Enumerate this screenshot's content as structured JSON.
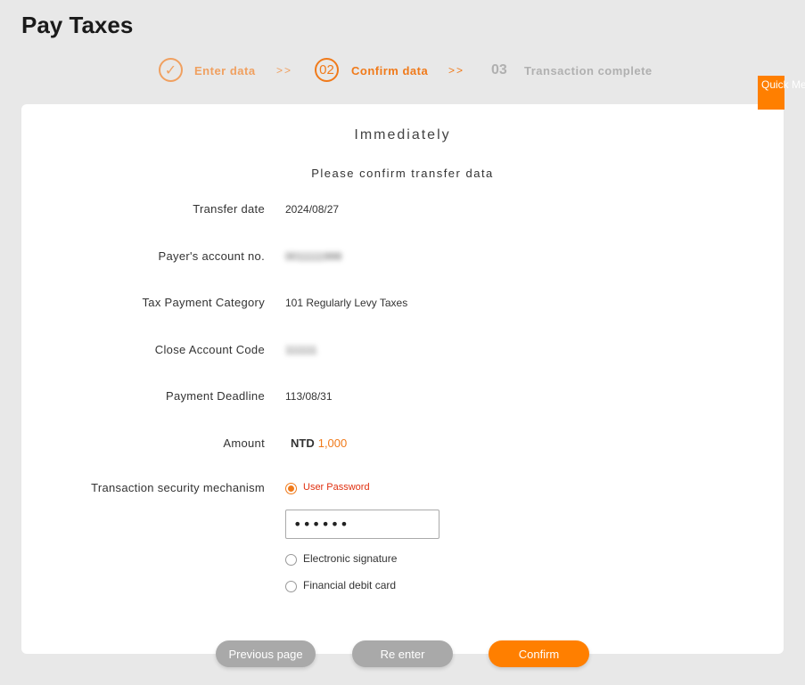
{
  "page": {
    "title": "Pay Taxes"
  },
  "stepper": {
    "step1": {
      "icon": "check-icon",
      "symbol": "✓",
      "label": "Enter data",
      "status": "done"
    },
    "separator1": ">>",
    "step2": {
      "number": "02",
      "label": "Confirm data",
      "status": "active"
    },
    "separator2": ">>",
    "step3": {
      "number": "03",
      "label": "Transaction complete",
      "status": "pending"
    }
  },
  "quick_menu": {
    "label": "Quick Menu"
  },
  "card": {
    "title": "Immediately",
    "subtitle": "Please confirm transfer data",
    "rows": {
      "transfer_date": {
        "label": "Transfer date",
        "value": "2024/08/27"
      },
      "payer_account": {
        "label": "Payer's account no.",
        "value": "0011111999"
      },
      "tax_category": {
        "label": "Tax Payment Category",
        "value": "101 Regularly Levy Taxes"
      },
      "close_account_code": {
        "label": "Close Account Code",
        "value": "111111"
      },
      "payment_deadline": {
        "label": "Payment Deadline",
        "value": "113/08/31"
      },
      "amount": {
        "label": "Amount",
        "currency": "NTD",
        "value": "1,000"
      }
    },
    "security": {
      "label": "Transaction security mechanism",
      "options": [
        {
          "label": "User Password",
          "selected": true
        },
        {
          "label": "Electronic signature",
          "selected": false
        },
        {
          "label": "Financial debit card",
          "selected": false
        }
      ],
      "password_value": "••••••"
    }
  },
  "buttons": {
    "previous": "Previous page",
    "reenter": "Re enter",
    "confirm": "Confirm"
  },
  "colors": {
    "accent": "#ff7f00",
    "accent_text": "#f07a1a",
    "step_done": "#f0a060",
    "step_pending": "#b0b0b0",
    "button_gray": "#a9a9a9",
    "background": "#e8e8e8",
    "alert_red": "#e03010"
  }
}
